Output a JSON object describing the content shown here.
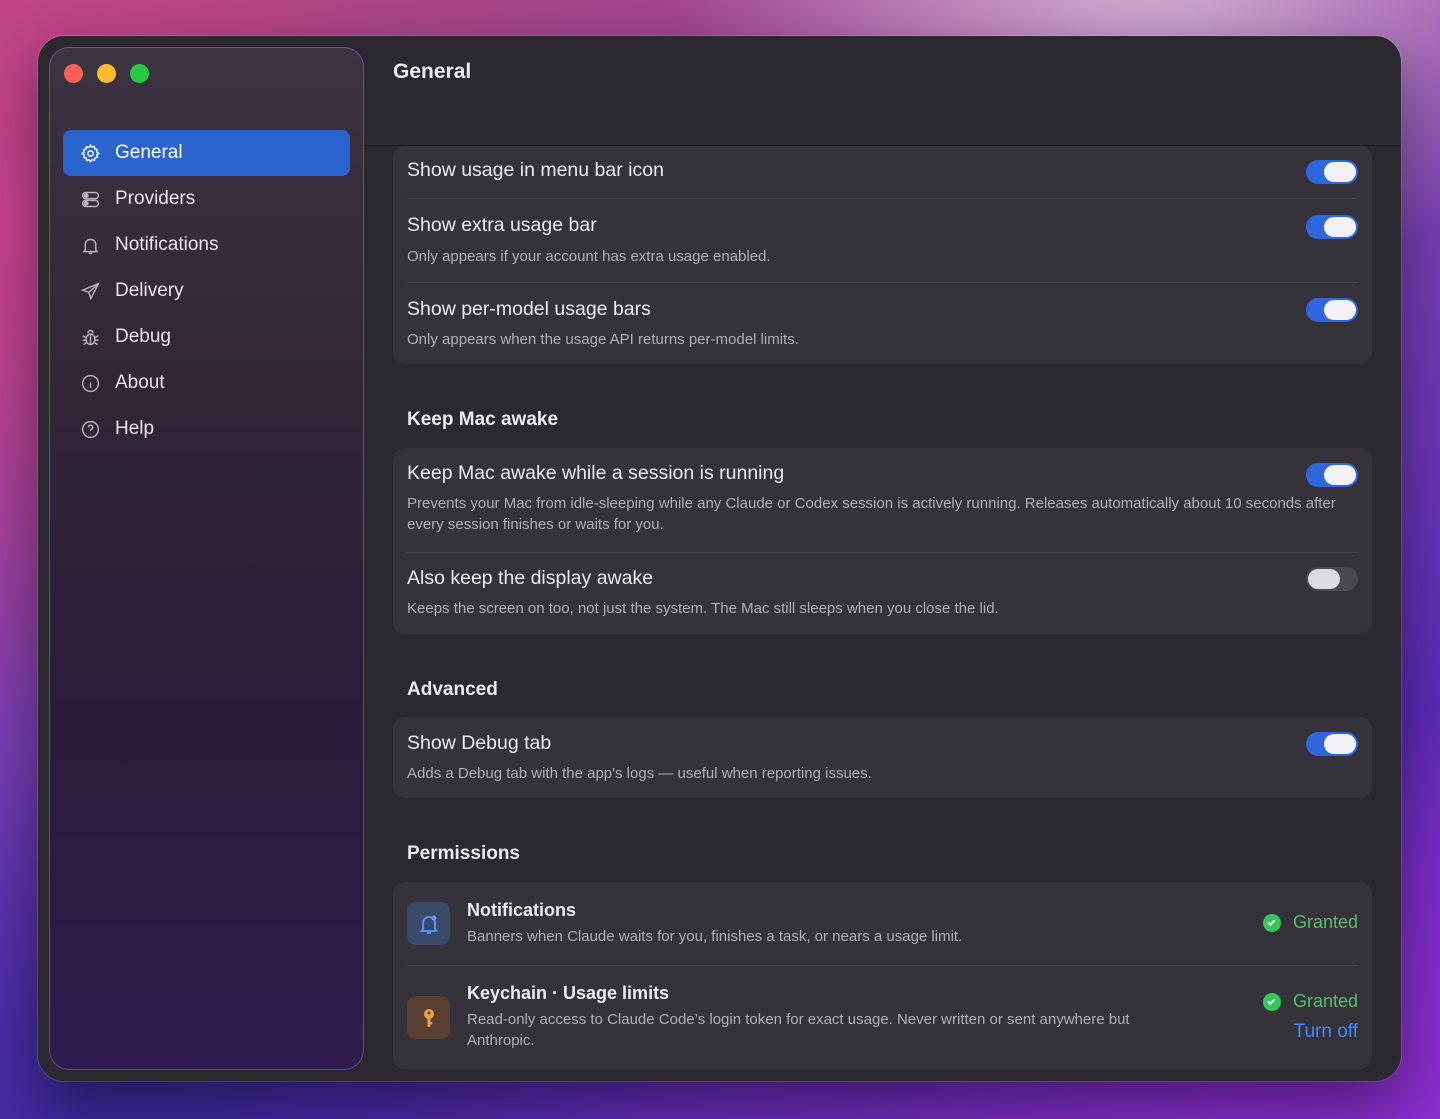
{
  "window": {
    "title": "General"
  },
  "sidebar": {
    "items": [
      {
        "label": "General",
        "icon": "gear-icon",
        "active": true
      },
      {
        "label": "Providers",
        "icon": "toggles-icon"
      },
      {
        "label": "Notifications",
        "icon": "bell-icon"
      },
      {
        "label": "Delivery",
        "icon": "paper-plane-icon"
      },
      {
        "label": "Debug",
        "icon": "bug-icon"
      },
      {
        "label": "About",
        "icon": "info-icon"
      },
      {
        "label": "Help",
        "icon": "question-icon"
      }
    ]
  },
  "usage": {
    "rows": [
      {
        "title": "Show usage in menu bar icon",
        "enabled": true
      },
      {
        "title": "Show extra usage bar",
        "desc": "Only appears if your account has extra usage enabled.",
        "enabled": true
      },
      {
        "title": "Show per-model usage bars",
        "desc": "Only appears when the usage API returns per-model limits.",
        "enabled": true
      }
    ]
  },
  "awake": {
    "header": "Keep Mac awake",
    "rows": [
      {
        "title": "Keep Mac awake while a session is running",
        "desc": "Prevents your Mac from idle-sleeping while any Claude or Codex session is actively running. Releases automatically about 10 seconds after every session finishes or waits for you.",
        "enabled": true
      },
      {
        "title": "Also keep the display awake",
        "desc": "Keeps the screen on too, not just the system. The Mac still sleeps when you close the lid.",
        "enabled": false
      }
    ]
  },
  "advanced": {
    "header": "Advanced",
    "rows": [
      {
        "title": "Show Debug tab",
        "desc": "Adds a Debug tab with the app's logs — useful when reporting issues.",
        "enabled": true
      }
    ]
  },
  "permissions": {
    "header": "Permissions",
    "items": [
      {
        "title": "Notifications",
        "desc": "Banners when Claude waits for you, finishes a task, or nears a usage limit.",
        "status": "Granted",
        "icon": "bell-icon"
      },
      {
        "title": "Keychain · Usage limits",
        "desc": "Read-only access to Claude Code’s login token for exact usage. Never written or sent anywhere but Anthropic.",
        "status": "Granted",
        "action": "Turn off",
        "icon": "key-icon"
      }
    ]
  },
  "colors": {
    "accent": "#2b63cf",
    "toggle_on": "#2d66de",
    "granted": "#34c759",
    "link": "#3f8bff"
  }
}
